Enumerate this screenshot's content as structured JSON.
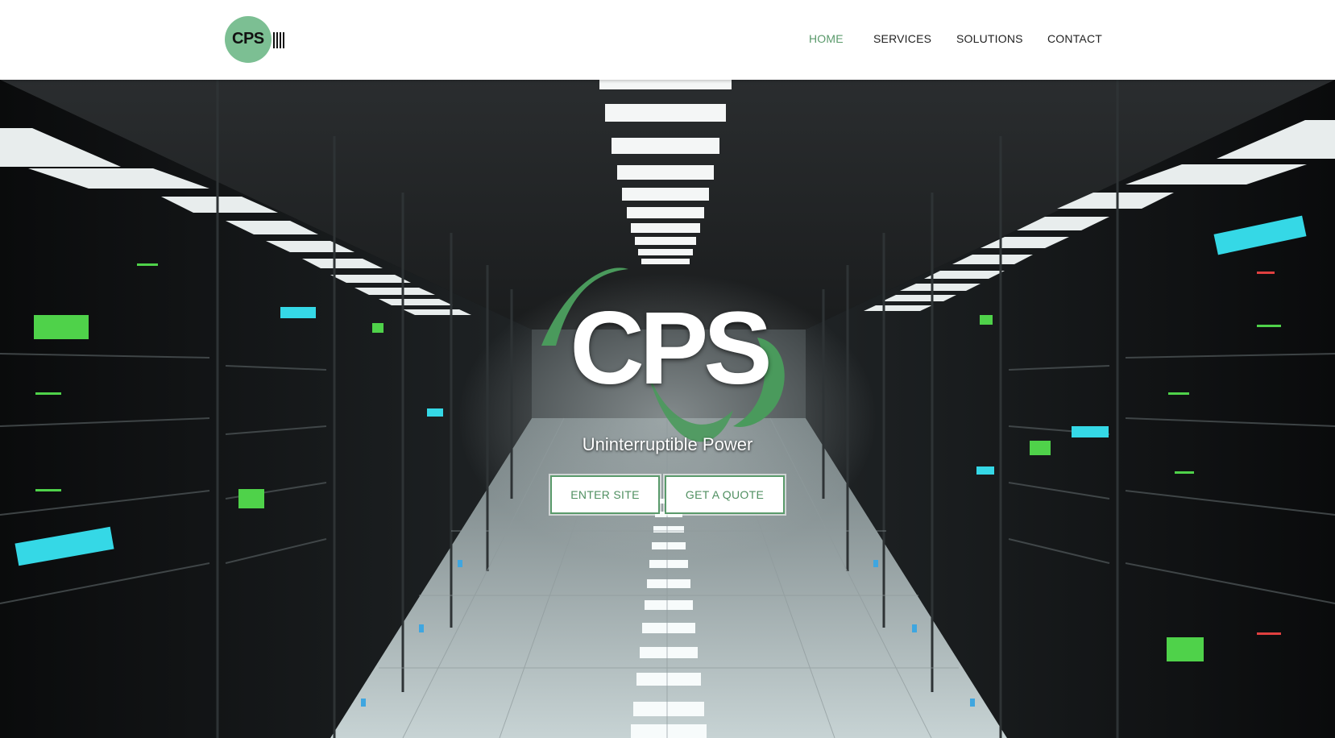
{
  "brand": {
    "logo_text": "CPS",
    "hero_title": "CPS",
    "tagline": "Uninterruptible Power"
  },
  "nav": {
    "items": [
      "HOME",
      "SERVICES",
      "SOLUTIONS",
      "CONTACT"
    ],
    "active": "HOME"
  },
  "hero": {
    "buttons": {
      "enter_site": "ENTER SITE",
      "get_quote": "GET A QUOTE"
    }
  },
  "colors": {
    "accent_green": "#5a9a6b",
    "logo_green": "#7cbf93",
    "header_bg": "#ffffff"
  },
  "icons": {
    "logo": "cps-logo-icon",
    "swoosh": "power-wave-icon"
  }
}
